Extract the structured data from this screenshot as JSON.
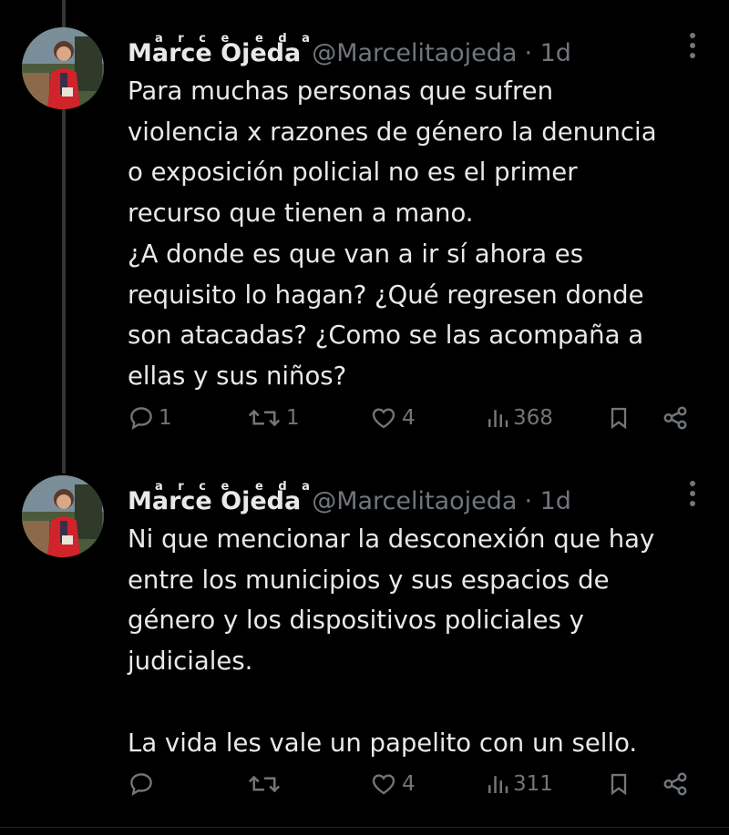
{
  "tweets": [
    {
      "display_name": "Marce Ojeda",
      "name_superscripts": [
        "a r c e",
        "e d a"
      ],
      "handle": "@Marcelitaojeda",
      "time": "· 1d",
      "text": "Para muchas personas que sufren\nviolencia x razones de género la denuncia\no exposición policial no es el primer\nrecurso que tienen a mano.\n¿A donde es que van a ir sí ahora es\nrequisito lo hagan? ¿Qué regresen donde\nson atacadas? ¿Como se las acompaña a\nellas y sus niños?",
      "replies": "1",
      "retweets": "1",
      "likes": "4",
      "views": "368"
    },
    {
      "display_name": "Marce Ojeda",
      "name_superscripts": [
        "a r c e",
        "e d a"
      ],
      "handle": "@Marcelitaojeda",
      "time": "· 1d",
      "text": "Ni que mencionar la desconexión que hay\nentre los municipios y sus espacios de\ngénero y los dispositivos policiales y\njudiciales.\n\nLa vida les vale un papelito con un sello.",
      "replies": "",
      "retweets": "",
      "likes": "4",
      "views": "311"
    }
  ],
  "colors": {
    "background": "#000000",
    "text": "#e7e9ea",
    "secondary": "#71767b",
    "thread_line": "#333639"
  }
}
